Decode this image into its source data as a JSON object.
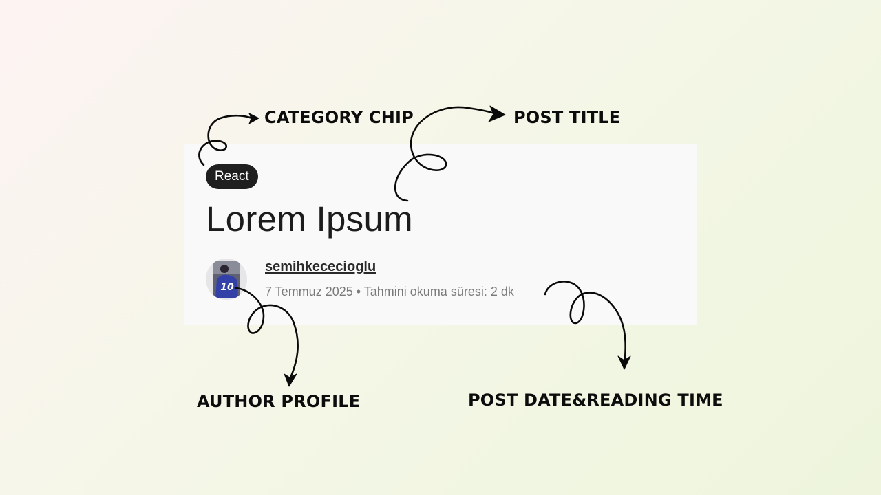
{
  "card": {
    "category_chip": "React",
    "post_title": "Lorem Ipsum",
    "author": {
      "name": "semihkececioglu",
      "avatar_jersey_number": "10"
    },
    "meta": {
      "date": "7 Temmuz 2025",
      "separator": "•",
      "reading_time_label": "Tahmini okuma süresi:",
      "reading_time_value": "2 dk"
    }
  },
  "annotations": {
    "category_chip": "CATEGORY CHIP",
    "post_title": "POST TITLE",
    "author_profile": "AUTHOR PROFILE",
    "post_date_reading_time": "POST DATE&READING TIME"
  },
  "colors": {
    "card_background": "#f9f9f9",
    "chip_background": "#1f1f1f",
    "title_text": "#1c1c1c",
    "meta_text": "#7a7a7a",
    "annotation_text": "#0c0c0c",
    "avatar_jersey": "#3340a8"
  }
}
